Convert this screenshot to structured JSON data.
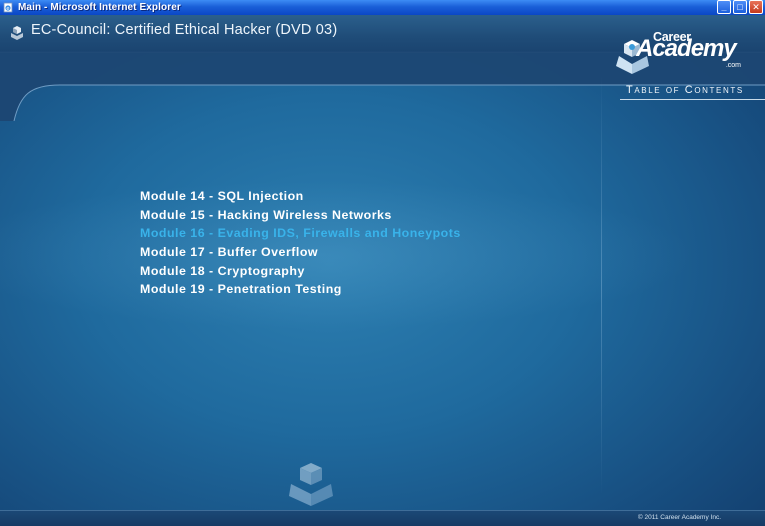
{
  "window": {
    "title": "Main - Microsoft Internet Explorer",
    "minimize": "_",
    "maximize": "□",
    "close": "✕"
  },
  "app": {
    "title": "EC-Council: Certified Ethical Hacker (DVD 03)",
    "logo": {
      "career": "Career",
      "academy": "Academy",
      "com": ".com"
    },
    "toc_heading": "Table of Contents",
    "modules": [
      {
        "label": "Module 14 - SQL Injection",
        "active": false
      },
      {
        "label": "Module 15 - Hacking Wireless Networks",
        "active": false
      },
      {
        "label": "Module 16 - Evading IDS, Firewalls and Honeypots",
        "active": true
      },
      {
        "label": "Module 17 - Buffer Overflow",
        "active": false
      },
      {
        "label": "Module 18 - Cryptography",
        "active": false
      },
      {
        "label": "Module 19 - Penetration Testing",
        "active": false
      }
    ],
    "copyright": "© 2011 Career Academy Inc."
  },
  "colors": {
    "accent": "#39b3ea",
    "menu_text": "#ffffff",
    "background": "#1f6a9e",
    "titlebar": "#1a5fd8"
  },
  "icons": {
    "window": "ie-page-icon",
    "app": "cube-book-icon",
    "logo": "career-academy-cube-icon"
  }
}
